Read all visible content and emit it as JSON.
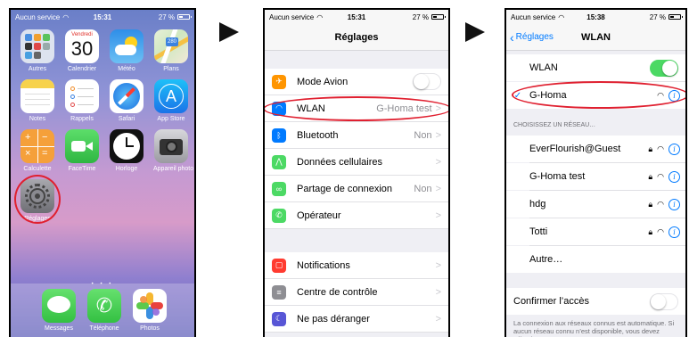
{
  "phone1": {
    "status": {
      "carrier": "Aucun service",
      "time": "15:31",
      "battery": "27 %"
    },
    "apps": [
      {
        "label": "Autres",
        "icon": "folder-icon"
      },
      {
        "label": "Calendrier",
        "icon": "calendar-icon",
        "day": "Vendredi",
        "date": "30"
      },
      {
        "label": "Météo",
        "icon": "weather-icon"
      },
      {
        "label": "Plans",
        "icon": "maps-icon"
      },
      {
        "label": "Notes",
        "icon": "notes-icon"
      },
      {
        "label": "Rappels",
        "icon": "reminders-icon"
      },
      {
        "label": "Safari",
        "icon": "safari-icon"
      },
      {
        "label": "App Store",
        "icon": "app-store-icon"
      },
      {
        "label": "Calculette",
        "icon": "calculator-icon"
      },
      {
        "label": "FaceTime",
        "icon": "facetime-icon"
      },
      {
        "label": "Horloge",
        "icon": "clock-icon"
      },
      {
        "label": "Appareil photo",
        "icon": "camera-icon"
      },
      {
        "label": "Réglages",
        "icon": "settings-gear-icon"
      }
    ],
    "dock": [
      {
        "label": "Messages",
        "icon": "messages-icon"
      },
      {
        "label": "Téléphone",
        "icon": "phone-icon"
      },
      {
        "label": "Photos",
        "icon": "photos-icon"
      }
    ]
  },
  "phone2": {
    "status": {
      "carrier": "Aucun service",
      "time": "15:31",
      "battery": "27 %"
    },
    "title": "Réglages",
    "rows": [
      {
        "label": "Mode Avion",
        "icon": "airplane-icon",
        "color": "#ff9500",
        "value": "",
        "toggle": "off"
      },
      {
        "label": "WLAN",
        "icon": "wifi-icon",
        "color": "#007aff",
        "value": "G-Homa test"
      },
      {
        "label": "Bluetooth",
        "icon": "bluetooth-icon",
        "color": "#007aff",
        "value": "Non"
      },
      {
        "label": "Données cellulaires",
        "icon": "cellular-icon",
        "color": "#4cd964",
        "value": ""
      },
      {
        "label": "Partage de connexion",
        "icon": "hotspot-icon",
        "color": "#4cd964",
        "value": "Non"
      },
      {
        "label": "Opérateur",
        "icon": "carrier-phone-icon",
        "color": "#4cd964",
        "value": ""
      },
      {
        "label": "Notifications",
        "icon": "notifications-icon",
        "color": "#ff3b30",
        "value": ""
      },
      {
        "label": "Centre de contrôle",
        "icon": "control-center-icon",
        "color": "#8e8e93",
        "value": ""
      },
      {
        "label": "Ne pas déranger",
        "icon": "moon-icon",
        "color": "#5856d6",
        "value": ""
      }
    ],
    "chevron": ">"
  },
  "phone3": {
    "status": {
      "carrier": "Aucun service",
      "time": "15:38",
      "battery": "27 %"
    },
    "back": "Réglages",
    "title": "WLAN",
    "wlan_label": "WLAN",
    "wlan_toggle": "on",
    "connected": "G-Homa",
    "section_header": "CHOISISSEZ UN RÉSEAU…",
    "networks": [
      "EverFlourish@Guest",
      "G-Homa test",
      "hdg",
      "Totti"
    ],
    "other": "Autre…",
    "ask_join_label": "Confirmer l’accès",
    "ask_join_toggle": "off",
    "footer": "La connexion aux réseaux connus est automatique. Si aucun réseau connu n’est disponible, vous devez sélectionner"
  },
  "colors": {
    "highlight": "#e02030",
    "ios_blue": "#007aff",
    "ios_green": "#4cd964"
  }
}
